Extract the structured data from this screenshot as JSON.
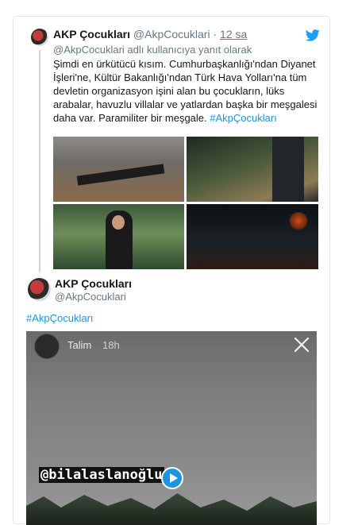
{
  "tweet1": {
    "name": "AKP Çocukları",
    "handle": "@AkpCocuklari",
    "separator": "·",
    "time": "12 sa",
    "reply_to": "@AkpCocuklari adlı kullanıcıya yanıt olarak",
    "text": "Şimdi en ürkütücü kısım. Cumhurbaşkanlığı'ndan Diyanet İşleri'ne, Kültür Bakanlığı'ndan Türk Hava Yolları'na tüm devletin organizasyon işini alan bu çocukların, lüks arabalar, havuzlu villalar ve yatlardan başka bir meşgalesi daha var. Paramiliter bir meşgale.",
    "hashtag": "#AkpÇocukları",
    "icon": "twitter-bird-icon"
  },
  "tweet2": {
    "name": "AKP Çocukları",
    "handle": "@AkpCocuklari",
    "hashtag": "#AkpÇocukları"
  },
  "video": {
    "story_label": "Talim",
    "story_time": "18h",
    "watermark": "@bilalaslanoğlu"
  },
  "colors": {
    "link": "#1b95e0",
    "muted": "#657786",
    "border": "#e1e8ed"
  }
}
